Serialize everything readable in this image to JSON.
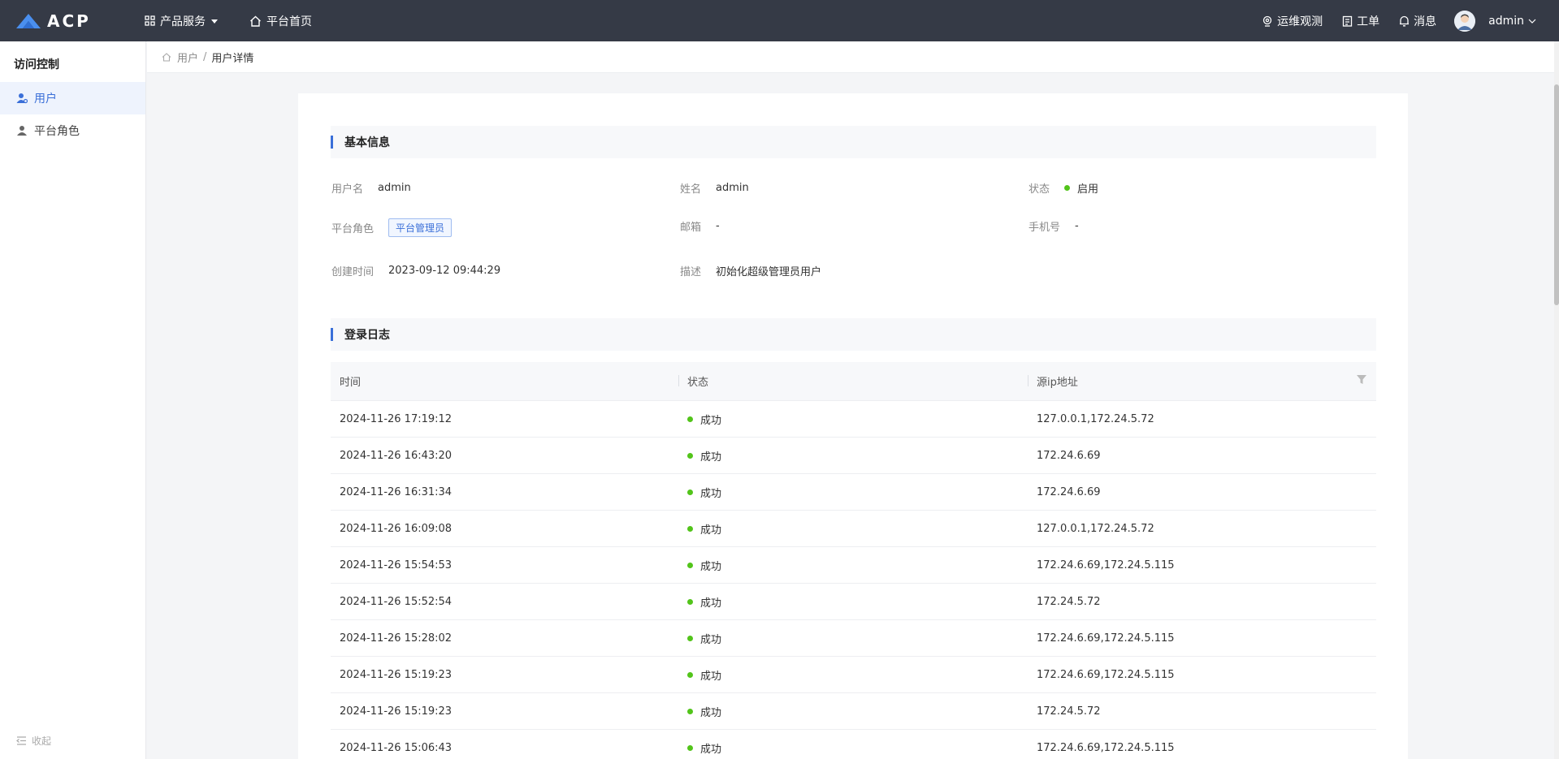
{
  "topbar": {
    "logo_text": "ACP",
    "nav": [
      {
        "label": "产品服务",
        "icon": "grid-icon"
      },
      {
        "label": "平台首页",
        "icon": "home-icon"
      }
    ],
    "right": [
      {
        "label": "运维观测",
        "icon": "monitor-icon"
      },
      {
        "label": "工单",
        "icon": "clipboard-icon"
      },
      {
        "label": "消息",
        "icon": "bell-icon"
      }
    ],
    "user": "admin"
  },
  "sidebar": {
    "title": "访问控制",
    "items": [
      {
        "label": "用户",
        "icon": "user-icon",
        "active": true
      },
      {
        "label": "平台角色",
        "icon": "role-icon",
        "active": false
      }
    ],
    "collapse_label": "收起"
  },
  "breadcrumb": {
    "parent": "用户",
    "separator": "/",
    "current": "用户详情"
  },
  "basic": {
    "title": "基本信息",
    "username_label": "用户名",
    "username": "admin",
    "name_label": "姓名",
    "name": "admin",
    "status_label": "状态",
    "status": "启用",
    "role_label": "平台角色",
    "role": "平台管理员",
    "email_label": "邮箱",
    "email": "-",
    "phone_label": "手机号",
    "phone": "-",
    "created_label": "创建时间",
    "created": "2023-09-12 09:44:29",
    "desc_label": "描述",
    "desc": "初始化超级管理员用户"
  },
  "log": {
    "title": "登录日志",
    "headers": [
      "时间",
      "状态",
      "源ip地址"
    ],
    "rows": [
      {
        "time": "2024-11-26 17:19:12",
        "status": "成功",
        "ip": "127.0.0.1,172.24.5.72"
      },
      {
        "time": "2024-11-26 16:43:20",
        "status": "成功",
        "ip": "172.24.6.69"
      },
      {
        "time": "2024-11-26 16:31:34",
        "status": "成功",
        "ip": "172.24.6.69"
      },
      {
        "time": "2024-11-26 16:09:08",
        "status": "成功",
        "ip": "127.0.0.1,172.24.5.72"
      },
      {
        "time": "2024-11-26 15:54:53",
        "status": "成功",
        "ip": "172.24.6.69,172.24.5.115"
      },
      {
        "time": "2024-11-26 15:52:54",
        "status": "成功",
        "ip": "172.24.5.72"
      },
      {
        "time": "2024-11-26 15:28:02",
        "status": "成功",
        "ip": "172.24.6.69,172.24.5.115"
      },
      {
        "time": "2024-11-26 15:19:23",
        "status": "成功",
        "ip": "172.24.6.69,172.24.5.115"
      },
      {
        "time": "2024-11-26 15:19:23",
        "status": "成功",
        "ip": "172.24.5.72"
      },
      {
        "time": "2024-11-26 15:06:43",
        "status": "成功",
        "ip": "172.24.6.69,172.24.5.115"
      }
    ]
  },
  "colors": {
    "topbar_bg": "#353a46",
    "accent": "#3a6fd8",
    "success": "#52c41a"
  }
}
